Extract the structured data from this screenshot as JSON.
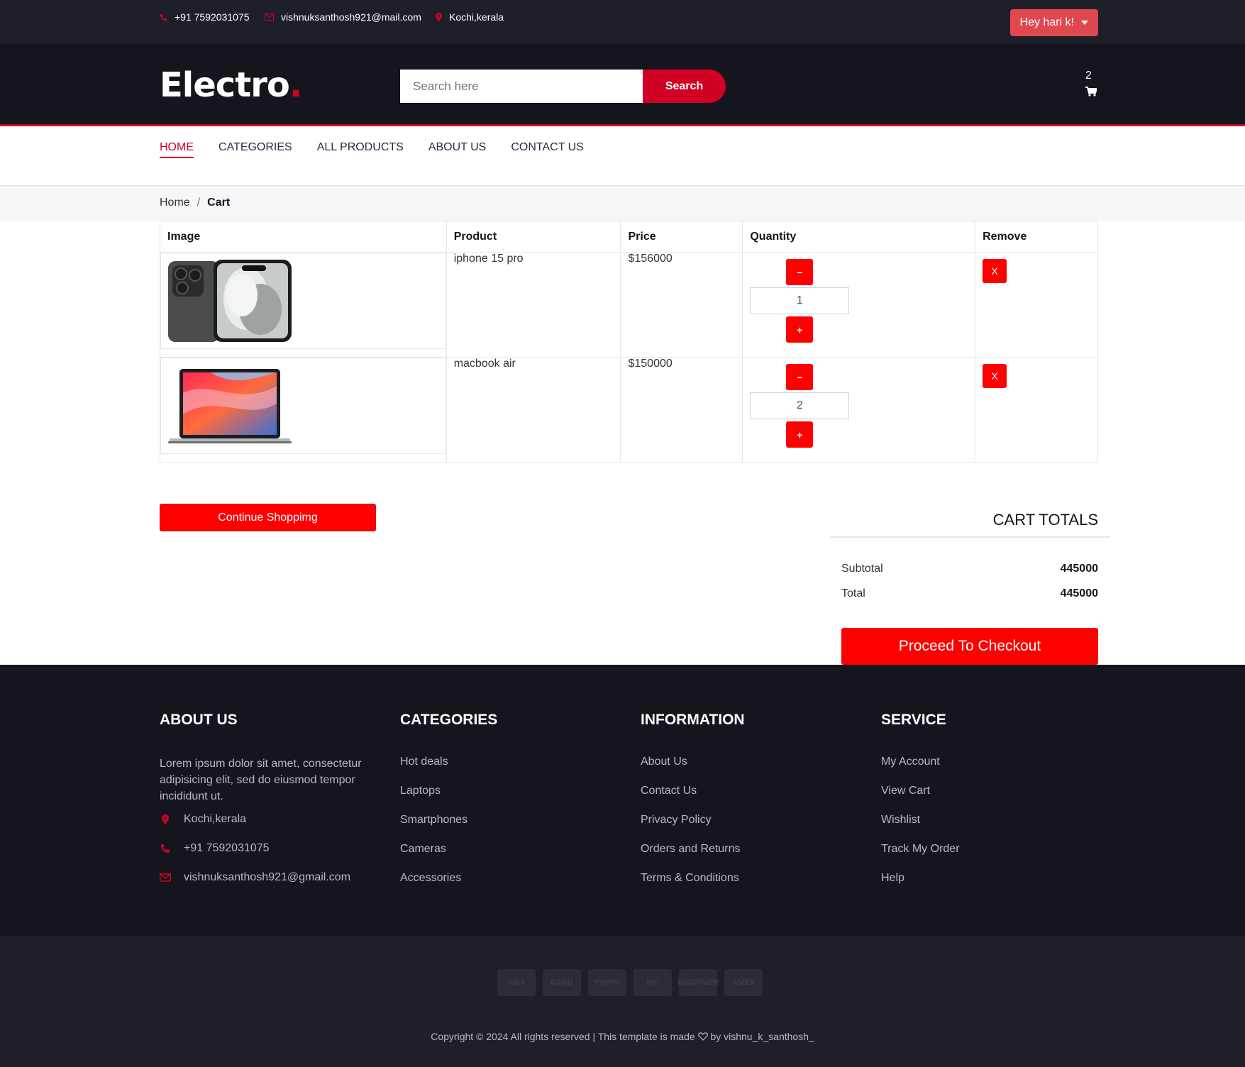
{
  "topbar": {
    "phone": "+91 7592031075",
    "email": "vishnuksanthosh921@mail.com",
    "location": "Kochi,kerala",
    "user_menu": "Hey hari k!"
  },
  "header": {
    "logo": "Electro",
    "logo_dot": ".",
    "search_placeholder": "Search here",
    "search_button": "Search",
    "cart_count": "2"
  },
  "nav": {
    "items": [
      "HOME",
      "CATEGORIES",
      "ALL PRODUCTS",
      "ABOUT US",
      "CONTACT US"
    ],
    "active": "HOME"
  },
  "breadcrumb": {
    "home": "Home",
    "separator": "/",
    "current": "Cart"
  },
  "cart": {
    "headers": {
      "image": "Image",
      "product": "Product",
      "price": "Price",
      "quantity": "Quantity",
      "remove": "Remove"
    },
    "items": [
      {
        "image_icon": "iphone-image",
        "name": "iphone 15 pro",
        "price": "$156000",
        "qty": "1",
        "minus": "−",
        "plus": "+",
        "remove": "X"
      },
      {
        "image_icon": "macbook-image",
        "name": "macbook air",
        "price": "$150000",
        "qty": "2",
        "minus": "−",
        "plus": "+",
        "remove": "X"
      }
    ],
    "continue_button": "Continue Shoppimg"
  },
  "totals": {
    "title": "CART TOTALS",
    "subtotal_label": "Subtotal",
    "subtotal_value": "445000",
    "total_label": "Total",
    "total_value": "445000",
    "checkout_button": "Proceed To Checkout"
  },
  "footer": {
    "about": {
      "title": "ABOUT US",
      "text": "Lorem ipsum dolor sit amet, consectetur adipisicing elit, sed do eiusmod tempor incididunt ut.",
      "location": "Kochi,kerala",
      "phone": "+91 7592031075",
      "email": "vishnuksanthosh921@gmail.com"
    },
    "categories": {
      "title": "CATEGORIES",
      "items": [
        "Hot deals",
        "Laptops",
        "Smartphones",
        "Cameras",
        "Accessories"
      ]
    },
    "information": {
      "title": "INFORMATION",
      "items": [
        "About Us",
        "Contact Us",
        "Privacy Policy",
        "Orders and Returns",
        "Terms & Conditions"
      ]
    },
    "service": {
      "title": "SERVICE",
      "items": [
        "My Account",
        "View Cart",
        "Wishlist",
        "Track My Order",
        "Help"
      ]
    },
    "payment_cards": [
      "VISA",
      "CARD",
      "PayPal",
      "MC",
      "DISCOVER",
      "AMEX"
    ],
    "copyright_pre": "Copyright © 2024 All rights reserved | This template is made",
    "copyright_post": "by vishnu_k_santhosh_"
  },
  "colors": {
    "accent": "#d10024",
    "button_red": "#ff0000",
    "dark": "#15161d",
    "topbar": "#1e1f29"
  }
}
